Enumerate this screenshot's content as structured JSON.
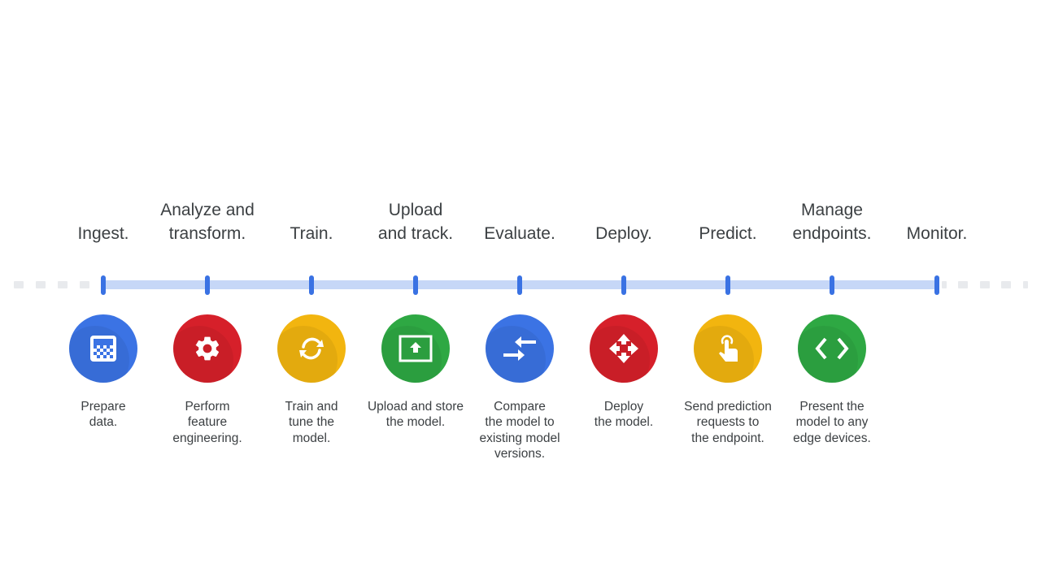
{
  "colors": {
    "blue": "#3b73e4",
    "red": "#d6202a",
    "yellow": "#f2b50f",
    "green": "#2ea843",
    "track": "#c6d7f7",
    "tick": "#3a72e3",
    "text": "#3c4043"
  },
  "stages": [
    {
      "label": "Ingest.",
      "icon": "data-grid-icon",
      "color": "blue",
      "description": "Prepare\ndata."
    },
    {
      "label": "Analyze and\ntransform.",
      "icon": "gear-icon",
      "color": "red",
      "description": "Perform\nfeature\nengineering."
    },
    {
      "label": "Train.",
      "icon": "sync-icon",
      "color": "yellow",
      "description": "Train and\ntune the\nmodel."
    },
    {
      "label": "Upload\nand track.",
      "icon": "upload-box-icon",
      "color": "green",
      "description": "Upload and store\nthe model."
    },
    {
      "label": "Evaluate.",
      "icon": "compare-arrows-icon",
      "color": "blue",
      "description": "Compare\nthe model to\nexisting model\nversions."
    },
    {
      "label": "Deploy.",
      "icon": "move-arrows-icon",
      "color": "red",
      "description": "Deploy\nthe model."
    },
    {
      "label": "Predict.",
      "icon": "touch-icon",
      "color": "yellow",
      "description": "Send prediction\nrequests to\nthe endpoint."
    },
    {
      "label": "Manage\nendpoints.",
      "icon": "code-brackets-icon",
      "color": "green",
      "description": "Present the\nmodel to any\nedge devices."
    },
    {
      "label": "Monitor.",
      "icon": null,
      "color": null,
      "description": null
    }
  ]
}
